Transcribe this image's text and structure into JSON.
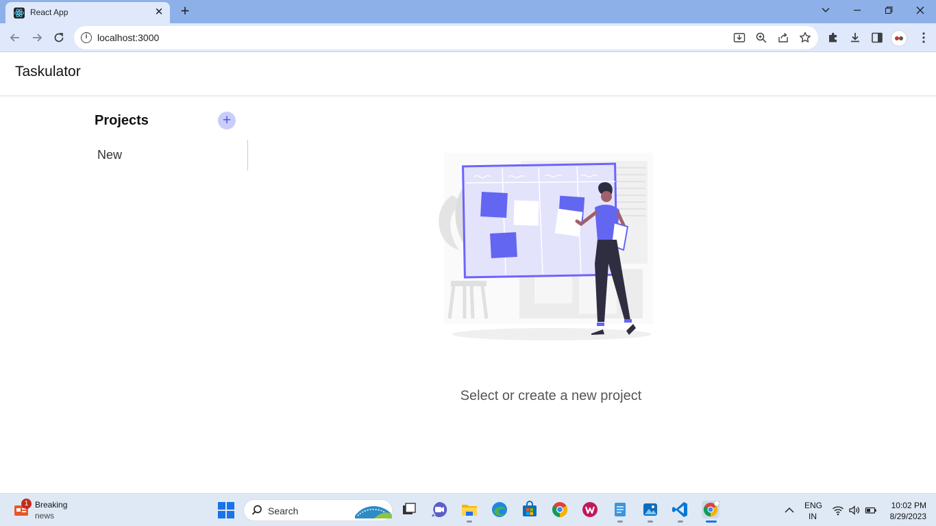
{
  "browser": {
    "tab_title": "React App",
    "url": "localhost:3000"
  },
  "app": {
    "title": "Taskulator",
    "sidebar": {
      "heading": "Projects",
      "add_label": "+",
      "projects": [
        {
          "name": "New"
        }
      ]
    },
    "empty_state": {
      "message": "Select or create a new project"
    },
    "colors": {
      "accent": "#6366f1",
      "accent_light": "#c9cdfa"
    }
  },
  "taskbar": {
    "news": {
      "badge": "1",
      "title": "Breaking",
      "subtitle": "news"
    },
    "search_placeholder": "Search",
    "language": {
      "line1": "ENG",
      "line2": "IN"
    },
    "clock": {
      "time": "10:02 PM",
      "date": "8/29/2023"
    }
  }
}
